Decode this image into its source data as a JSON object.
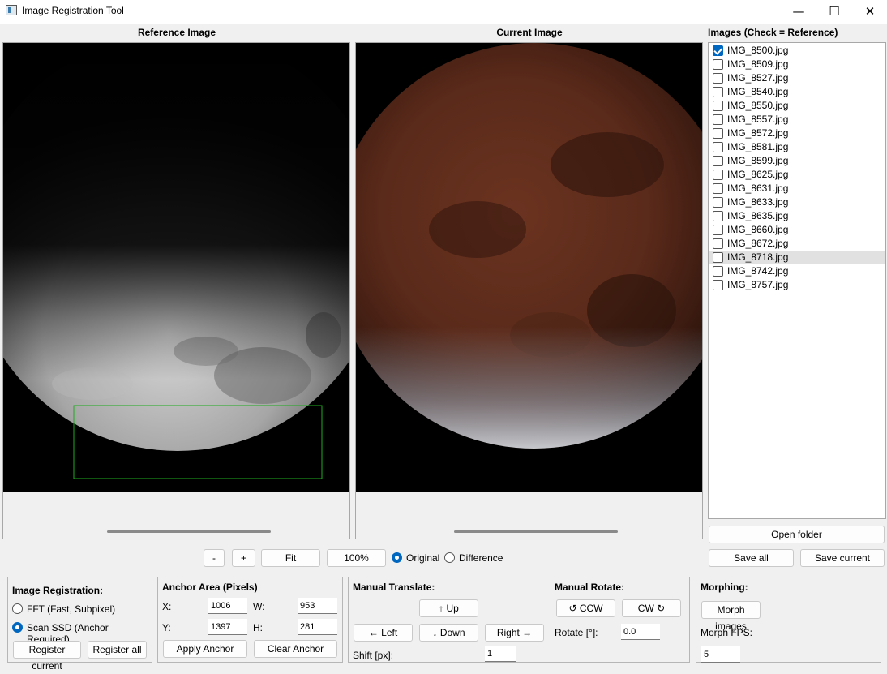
{
  "window": {
    "title": "Image Registration Tool",
    "minimize": "—",
    "maximize": "☐",
    "close": "✕"
  },
  "reference": {
    "title": "Reference Image"
  },
  "current": {
    "title": "Current Image"
  },
  "images": {
    "title": "Images (Check = Reference)",
    "items": [
      {
        "name": "IMG_8500.jpg",
        "checked": true
      },
      {
        "name": "IMG_8509.jpg",
        "checked": false
      },
      {
        "name": "IMG_8527.jpg",
        "checked": false
      },
      {
        "name": "IMG_8540.jpg",
        "checked": false
      },
      {
        "name": "IMG_8550.jpg",
        "checked": false
      },
      {
        "name": "IMG_8557.jpg",
        "checked": false
      },
      {
        "name": "IMG_8572.jpg",
        "checked": false
      },
      {
        "name": "IMG_8581.jpg",
        "checked": false
      },
      {
        "name": "IMG_8599.jpg",
        "checked": false
      },
      {
        "name": "IMG_8625.jpg",
        "checked": false
      },
      {
        "name": "IMG_8631.jpg",
        "checked": false
      },
      {
        "name": "IMG_8633.jpg",
        "checked": false
      },
      {
        "name": "IMG_8635.jpg",
        "checked": false
      },
      {
        "name": "IMG_8660.jpg",
        "checked": false
      },
      {
        "name": "IMG_8672.jpg",
        "checked": false
      },
      {
        "name": "IMG_8718.jpg",
        "checked": false,
        "highlighted": true
      },
      {
        "name": "IMG_8742.jpg",
        "checked": false
      },
      {
        "name": "IMG_8757.jpg",
        "checked": false
      }
    ],
    "open_folder": "Open folder",
    "save_all": "Save all",
    "save_current": "Save current"
  },
  "zoom": {
    "minus": "-",
    "plus": "+",
    "fit": "Fit",
    "percent": "100%",
    "original": "Original",
    "difference": "Difference",
    "selected_mode": "Original"
  },
  "registration": {
    "title": "Image Registration:",
    "fft": "FFT (Fast, Subpixel)",
    "ssd": "Scan SSD (Anchor Required)",
    "selected": "Scan SSD (Anchor Required)",
    "register_current": "Register current",
    "register_all": "Register all"
  },
  "anchor": {
    "title": "Anchor Area (Pixels)",
    "x_label": "X:",
    "x": "1006",
    "y_label": "Y:",
    "y": "1397",
    "w_label": "W:",
    "w": "953",
    "h_label": "H:",
    "h": "281",
    "apply": "Apply Anchor",
    "clear": "Clear Anchor"
  },
  "translate": {
    "title": "Manual Translate:",
    "up": "↑ Up",
    "left": "← Left",
    "down": "↓ Down",
    "right": "Right →",
    "shift_label": "Shift [px]:",
    "shift": "1"
  },
  "rotate": {
    "title": "Manual Rotate:",
    "ccw": "↺ CCW",
    "cw": "CW ↻",
    "rotate_label": "Rotate [°]:",
    "rotate": "0.0"
  },
  "morphing": {
    "title": "Morphing:",
    "morph_button": "Morph images",
    "fps_label": "Morph FPS:",
    "fps": "5"
  },
  "colors": {
    "accent": "#0067c0",
    "anchor_box": "#1faa1f",
    "list_highlight": "#e1e1e1"
  }
}
